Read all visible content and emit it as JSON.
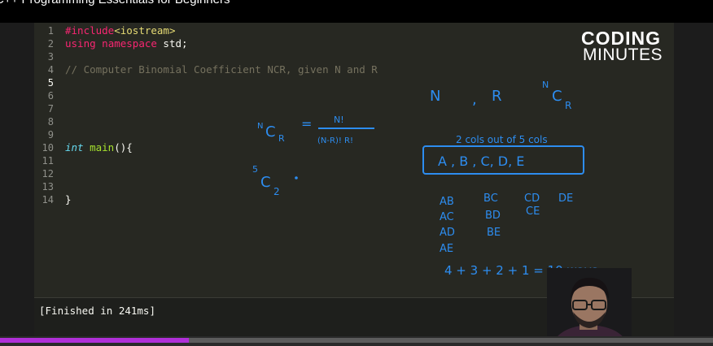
{
  "window": {
    "title": "C++ Programming Essentials for Beginners"
  },
  "brand": {
    "logo_line1": "CODING",
    "logo_line2": "MINUTES"
  },
  "editor": {
    "active_line": 5,
    "line_numbers": [
      "1",
      "2",
      "3",
      "4",
      "5",
      "6",
      "7",
      "8",
      "9",
      "10",
      "11",
      "12",
      "13",
      "14"
    ],
    "code": {
      "l1_kw": "#include",
      "l1_str": "<iostream>",
      "l2_kw1": "using",
      "l2_kw2": "namespace",
      "l2_rest": " std;",
      "l4": "// Computer Binomial Coefficient NCR, given N and R",
      "l10_type": "int",
      "l10_fn": "main",
      "l10_rest": "(){",
      "l14": "}"
    }
  },
  "output": {
    "text": "[Finished in 241ms]"
  },
  "annotations": {
    "n": "N",
    "comma": ",",
    "r": "R",
    "ncr_n": "N",
    "ncr_c": "C",
    "ncr_r": "R",
    "formula_lhs_n": "N",
    "formula_lhs_c": "C",
    "formula_lhs_r": "R",
    "eq": "=",
    "numerator": "N!",
    "denominator": "(N-R)! R!",
    "example_sup": "5",
    "example_c": "C",
    "example_sub": "2",
    "select_note": "2 cols out of 5 cols",
    "set_items": "A , B , C, D, E",
    "pairs_col1": [
      "AB",
      "AC",
      "AD",
      "AE"
    ],
    "pairs_col2": [
      "BC",
      "BD",
      "BE"
    ],
    "pairs_col3": [
      "CD",
      "CE"
    ],
    "pairs_col4": [
      "DE"
    ],
    "sum": "4 + 3 + 2 + 1 = 10 ways"
  },
  "player": {
    "progress": 0.265,
    "colors": {
      "played": "#b02fd8",
      "track": "#5c5c5c"
    }
  }
}
